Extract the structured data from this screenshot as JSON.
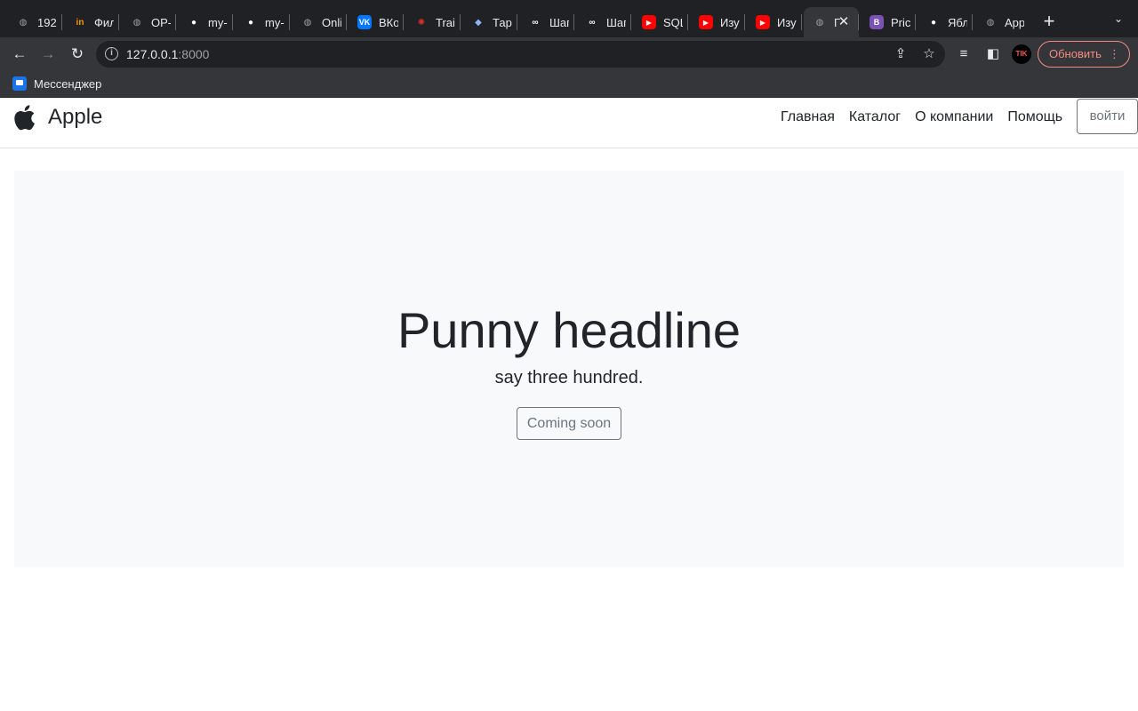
{
  "browser": {
    "tabs": [
      {
        "title": "192",
        "icon": "globe-icon",
        "color": "#9aa0a6"
      },
      {
        "title": "Фил",
        "icon": "in-logo-icon",
        "color": "#f29900"
      },
      {
        "title": "OP-",
        "icon": "globe-icon",
        "color": "#9aa0a6"
      },
      {
        "title": "my-",
        "icon": "github-icon",
        "color": "#ffffff"
      },
      {
        "title": "my-",
        "icon": "github-icon",
        "color": "#ffffff"
      },
      {
        "title": "Onli",
        "icon": "globe-icon",
        "color": "#9aa0a6"
      },
      {
        "title": "ВКо",
        "icon": "vk-icon",
        "color": "#0077ff"
      },
      {
        "title": "Trair",
        "icon": "openai-icon",
        "color": "#d93025"
      },
      {
        "title": "Тарі",
        "icon": "shield-icon",
        "color": "#8ab4f8"
      },
      {
        "title": "Шаг",
        "icon": "link-icon",
        "color": "#ffffff"
      },
      {
        "title": "Шаг",
        "icon": "link-icon",
        "color": "#ffffff"
      },
      {
        "title": "SQL",
        "icon": "youtube-icon",
        "color": "#ff0000"
      },
      {
        "title": "Изу",
        "icon": "youtube-icon",
        "color": "#ff0000"
      },
      {
        "title": "Изу",
        "icon": "youtube-icon",
        "color": "#ff0000"
      },
      {
        "title": "Г",
        "icon": "globe-icon",
        "color": "#9aa0a6",
        "active": true
      },
      {
        "title": "Pric",
        "icon": "bootstrap-icon",
        "color": "#7952b3"
      },
      {
        "title": "Ябл",
        "icon": "apple-icon",
        "color": "#ffffff"
      },
      {
        "title": "App",
        "icon": "globe-icon",
        "color": "#9aa0a6"
      }
    ],
    "new_tab": "+",
    "tab_search": "⌄",
    "address": {
      "host": "127.0.0.1",
      "port": ":8000"
    },
    "update_label": "Обновить",
    "update_menu": "⋮",
    "profile": "TIK",
    "bookmark": "Мессенджер"
  },
  "site": {
    "brand": "Apple",
    "nav": [
      "Главная",
      "Каталог",
      "О компании",
      "Помощь"
    ],
    "login": "войти",
    "hero": {
      "title": "Punny headline",
      "lead": "say three hundred.",
      "button": "Coming soon"
    }
  }
}
